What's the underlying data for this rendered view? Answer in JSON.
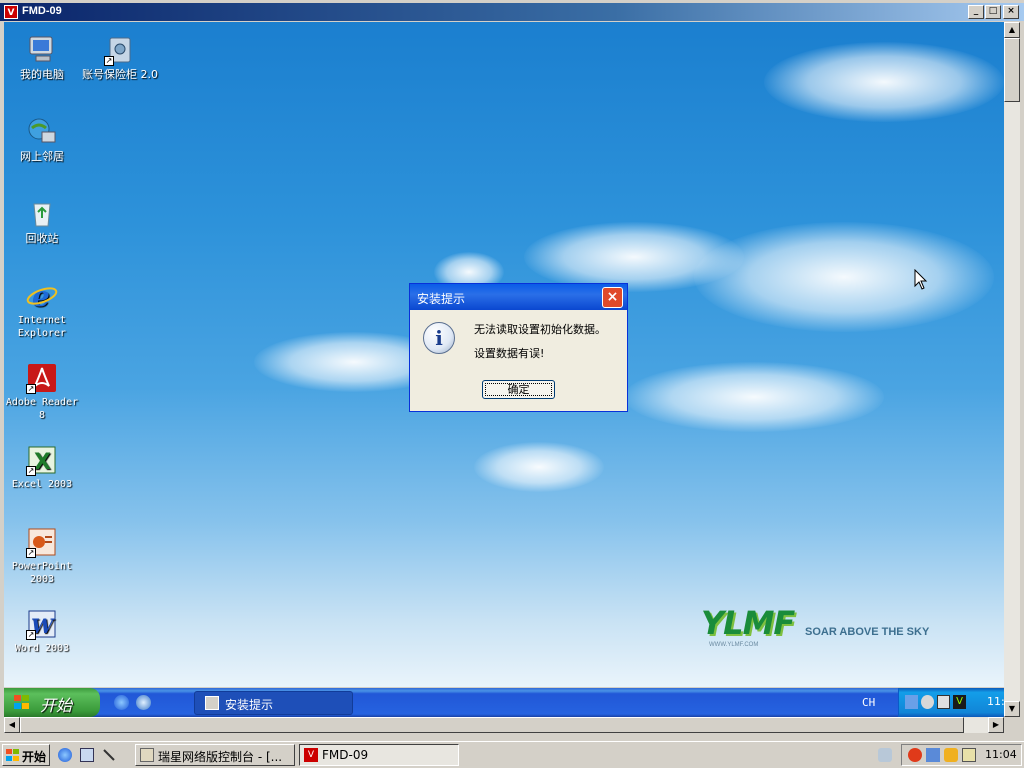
{
  "viewer": {
    "title": "FMD-09",
    "icon_text": "V",
    "minimize": "_",
    "maximize": "□",
    "close": "×"
  },
  "desktop_icons": [
    {
      "label": "我的电脑",
      "cn": true
    },
    {
      "label": "账号保险柜 2.0",
      "cn": true
    },
    {
      "label": "网上邻居",
      "cn": true
    },
    {
      "label": "回收站",
      "cn": true
    },
    {
      "label": "Internet Explorer",
      "cn": false
    },
    {
      "label": "Adobe Reader 8",
      "cn": false
    },
    {
      "label": "Excel 2003",
      "cn": false
    },
    {
      "label": "PowerPoint 2003",
      "cn": false
    },
    {
      "label": "Word 2003",
      "cn": false
    }
  ],
  "branding": {
    "logo": "YLMF",
    "slogan": "SOAR ABOVE THE SKY",
    "url": "WWW.YLMF.COM"
  },
  "dialog": {
    "title": "安装提示",
    "close": "×",
    "line1": "无法读取设置初始化数据。",
    "line2": "设置数据有误!",
    "ok": "确定",
    "icon_glyph": "i"
  },
  "remote_taskbar": {
    "start": "开始",
    "task": "安装提示",
    "lang": "CH",
    "clock": "11:"
  },
  "host_taskbar": {
    "start": "开始",
    "tasks": [
      "瑞星网络版控制台 - [...",
      "FMD-09"
    ],
    "clock": "11:04"
  },
  "colors": {
    "xp_blue": "#2663e0",
    "start_green": "#3a9a3a",
    "dialog_title": "#0a5ce8",
    "close_red": "#e04a2a"
  }
}
